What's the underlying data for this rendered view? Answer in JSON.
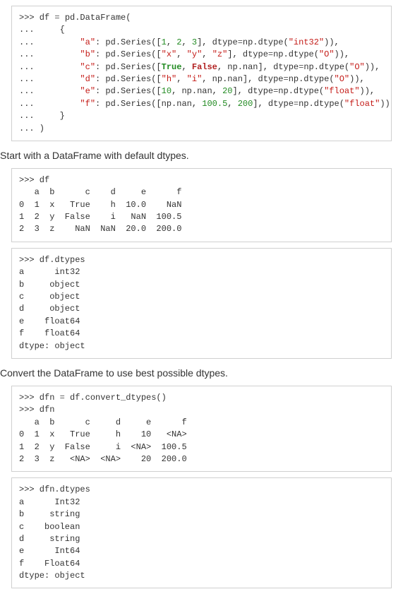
{
  "code1": {
    "l1a": ">>> df ",
    "l1b": "=",
    "l1c": " pd.DataFrame(",
    "l2": "...     {",
    "l3a": "...         ",
    "l3s": "\"a\"",
    "l3b": ": pd.Series([",
    "l3n1": "1",
    "l3c": ", ",
    "l3n2": "2",
    "l3d": ", ",
    "l3n3": "3",
    "l3e": "], dtype",
    "l3f": "=",
    "l3g": "np.dtype(",
    "l3s2": "\"int32\"",
    "l3h": ")),",
    "l4a": "...         ",
    "l4s": "\"b\"",
    "l4b": ": pd.Series([",
    "l4s1": "\"x\"",
    "l4c": ", ",
    "l4s2": "\"y\"",
    "l4d": ", ",
    "l4s3": "\"z\"",
    "l4e": "], dtype",
    "l4f": "=",
    "l4g": "np.dtype(",
    "l4s4": "\"O\"",
    "l4h": ")),",
    "l5a": "...         ",
    "l5s": "\"c\"",
    "l5b": ": pd.Series([",
    "l5t": "True",
    "l5c": ", ",
    "l5f": "False",
    "l5d": ", np.nan], dtype",
    "l5e": "=",
    "l5g": "np.dtype(",
    "l5s2": "\"O\"",
    "l5h": ")),",
    "l6a": "...         ",
    "l6s": "\"d\"",
    "l6b": ": pd.Series([",
    "l6s1": "\"h\"",
    "l6c": ", ",
    "l6s2": "\"i\"",
    "l6d": ", np.nan], dtype",
    "l6e": "=",
    "l6g": "np.dtype(",
    "l6s3": "\"O\"",
    "l6h": ")),",
    "l7a": "...         ",
    "l7s": "\"e\"",
    "l7b": ": pd.Series([",
    "l7n1": "10",
    "l7c": ", np.nan, ",
    "l7n2": "20",
    "l7d": "], dtype",
    "l7e": "=",
    "l7g": "np.dtype(",
    "l7s2": "\"float\"",
    "l7h": ")),",
    "l8a": "...         ",
    "l8s": "\"f\"",
    "l8b": ": pd.Series([np.nan, ",
    "l8n1": "100.5",
    "l8c": ", ",
    "l8n2": "200",
    "l8d": "], dtype",
    "l8e": "=",
    "l8g": "np.dtype(",
    "l8s2": "\"float\"",
    "l8h": ")),",
    "l9": "...     }",
    "l10": "... )"
  },
  "prose1": "Start with a DataFrame with default dtypes.",
  "code2": ">>> df\n   a  b      c    d     e      f\n0  1  x   True    h  10.0    NaN\n1  2  y  False    i   NaN  100.5\n2  3  z    NaN  NaN  20.0  200.0",
  "code3": ">>> df.dtypes\na      int32\nb     object\nc     object\nd     object\ne    float64\nf    float64\ndtype: object",
  "prose2": "Convert the DataFrame to use best possible dtypes.",
  "code4": {
    "l1a": ">>> dfn ",
    "l1b": "=",
    "l1c": " df.convert_dtypes()",
    "l2": ">>> dfn",
    "rest": "   a  b      c     d     e      f\n0  1  x   True     h    10   <NA>\n1  2  y  False     i  <NA>  100.5\n2  3  z   <NA>  <NA>    20  200.0"
  },
  "code5": ">>> dfn.dtypes\na      Int32\nb     string\nc    boolean\nd     string\ne      Int64\nf    Float64\ndtype: object"
}
